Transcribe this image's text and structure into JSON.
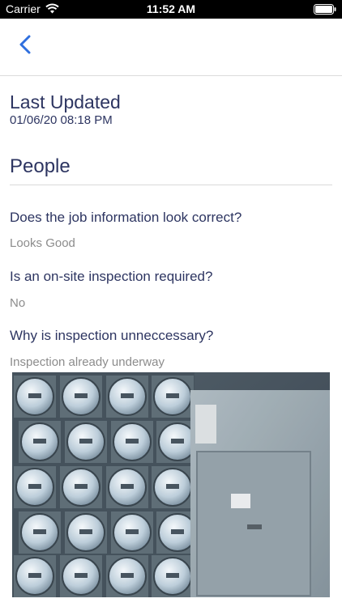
{
  "status_bar": {
    "carrier": "Carrier",
    "time": "11:52 AM"
  },
  "header": {
    "back_icon": "chevron-left-icon"
  },
  "last_updated": {
    "title": "Last Updated",
    "value": "01/06/20 08:18 PM"
  },
  "section": {
    "title": "People"
  },
  "questions": [
    {
      "question": "Does the job information look correct?",
      "answer": "Looks Good"
    },
    {
      "question": "Is an on-site inspection required?",
      "answer": "No"
    },
    {
      "question": "Why is inspection unneccessary?",
      "answer": "Inspection already underway"
    }
  ],
  "colors": {
    "accent": "#2f6fde",
    "heading": "#2d3561",
    "muted": "#8c8c8c"
  }
}
